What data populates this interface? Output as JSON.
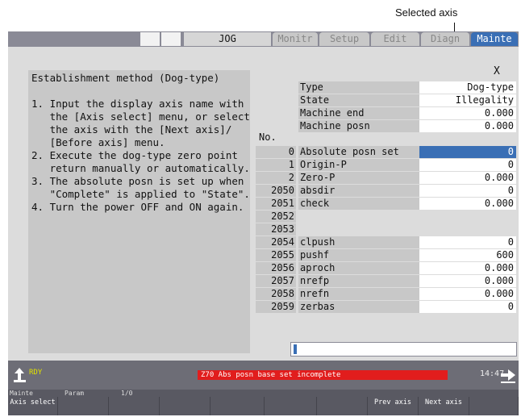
{
  "annotation": {
    "selected_axis": "Selected axis"
  },
  "topbar": {
    "mode": "JOG",
    "tabs": [
      "Monitr",
      "Setup",
      "Edit",
      "Diagn",
      "Mainte"
    ],
    "active_tab": "Mainte"
  },
  "axis_label": "X",
  "instructions": {
    "title": "Establishment method (Dog-type)",
    "lines": [
      "1. Input the display axis name with",
      "   the [Axis select] menu, or select",
      "   the axis with the [Next axis]/",
      "   [Before axis] menu.",
      "2. Execute the dog-type zero point",
      "   return manually or automatically.",
      "3. The absolute posn is set up when",
      "   \"Complete\" is applied to \"State\".",
      "4. Turn the power OFF and ON again."
    ]
  },
  "info": [
    {
      "name": "Type",
      "value": "Dog-type"
    },
    {
      "name": "State",
      "value": "Illegality"
    },
    {
      "name": "Machine end",
      "value": "0.000"
    },
    {
      "name": "Machine posn",
      "value": "0.000"
    }
  ],
  "params_header": "No.",
  "params": [
    {
      "no": "0",
      "name": "Absolute posn set",
      "value": "0"
    },
    {
      "no": "1",
      "name": "Origin-P",
      "value": "0"
    },
    {
      "no": "2",
      "name": "Zero-P",
      "value": "0.000"
    },
    {
      "no": "2050",
      "name": "absdir",
      "value": "0"
    },
    {
      "no": "2051",
      "name": "check",
      "value": "0.000"
    },
    {
      "no": "2052",
      "name": "",
      "value": ""
    },
    {
      "no": "2053",
      "name": "",
      "value": ""
    },
    {
      "no": "2054",
      "name": "clpush",
      "value": "0"
    },
    {
      "no": "2055",
      "name": "pushf",
      "value": "600"
    },
    {
      "no": "2056",
      "name": "aproch",
      "value": "0.000"
    },
    {
      "no": "2057",
      "name": "nrefp",
      "value": "0.000"
    },
    {
      "no": "2058",
      "name": "nrefn",
      "value": "0.000"
    },
    {
      "no": "2059",
      "name": "zerbas",
      "value": "0"
    }
  ],
  "status": {
    "ready": "RDY",
    "message": "Z70  Abs posn base set incomplete",
    "time": "14:47"
  },
  "menu_header": {
    "group": "Mainte",
    "sub": "Param",
    "page": "1/0"
  },
  "menu_keys": [
    "Axis select",
    "",
    "",
    "",
    "",
    "",
    "",
    "Prev axis",
    "Next axis",
    ""
  ],
  "colors": {
    "accent": "#3a6fb5",
    "alarm": "#e11d1d"
  }
}
